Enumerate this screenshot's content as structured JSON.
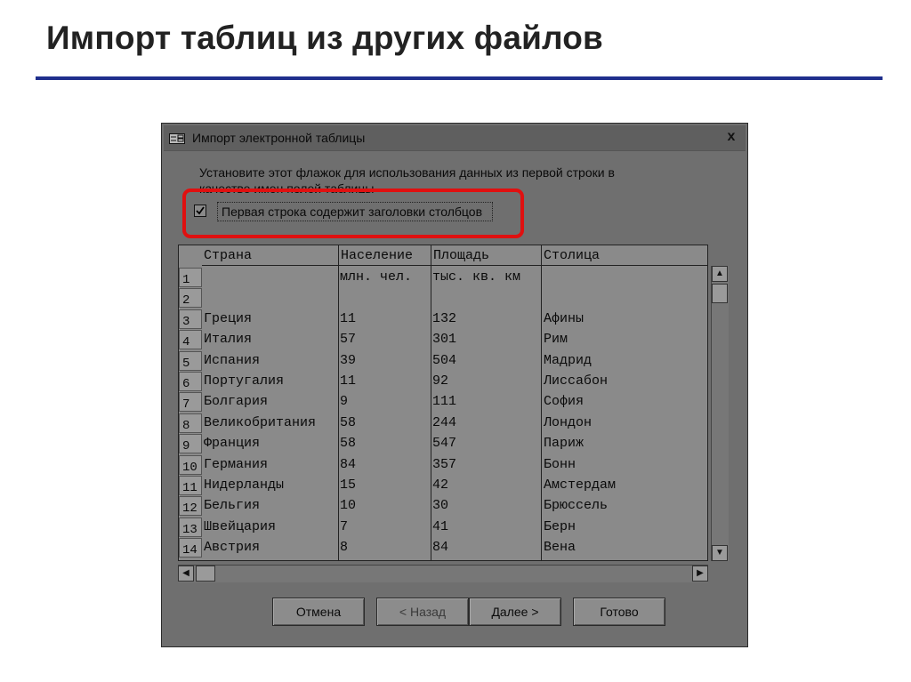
{
  "slide": {
    "title": "Импорт таблиц из других файлов",
    "accent_color": "#1f2f8c"
  },
  "dialog": {
    "title": "Импорт электронной таблицы",
    "close_label": "x",
    "instruction": "Установите этот флажок для использования данных из первой строки в качестве имен полей таблицы",
    "checkbox": {
      "label": "Первая строка содержит заголовки столбцов",
      "checked": true
    },
    "highlight_color": "#e01010"
  },
  "grid": {
    "columns": [
      "Страна",
      "Население",
      "Площадь",
      "Столица"
    ],
    "rows": [
      {
        "num": "1",
        "cells": [
          "",
          "млн. чел.",
          "тыс. кв. км",
          ""
        ]
      },
      {
        "num": "2",
        "cells": [
          "",
          "",
          "",
          ""
        ]
      },
      {
        "num": "3",
        "cells": [
          "Греция",
          "11",
          "132",
          "Афины"
        ]
      },
      {
        "num": "4",
        "cells": [
          "Италия",
          "57",
          "301",
          "Рим"
        ]
      },
      {
        "num": "5",
        "cells": [
          "Испания",
          "39",
          "504",
          "Мадрид"
        ]
      },
      {
        "num": "6",
        "cells": [
          "Португалия",
          "11",
          "92",
          "Лиссабон"
        ]
      },
      {
        "num": "7",
        "cells": [
          "Болгария",
          "9",
          "111",
          "София"
        ]
      },
      {
        "num": "8",
        "cells": [
          "Великобритания",
          "58",
          "244",
          "Лондон"
        ]
      },
      {
        "num": "9",
        "cells": [
          "Франция",
          "58",
          "547",
          "Париж"
        ]
      },
      {
        "num": "10",
        "cells": [
          "Германия",
          "84",
          "357",
          "Бонн"
        ]
      },
      {
        "num": "11",
        "cells": [
          "Нидерланды",
          "15",
          "42",
          "Амстердам"
        ]
      },
      {
        "num": "12",
        "cells": [
          "Бельгия",
          "10",
          "30",
          "Брюссель"
        ]
      },
      {
        "num": "13",
        "cells": [
          "Швейцария",
          "7",
          "41",
          "Берн"
        ]
      },
      {
        "num": "14",
        "cells": [
          "Австрия",
          "8",
          "84",
          "Вена"
        ]
      }
    ]
  },
  "scrollbars": {
    "up_icon": "triangle-up-icon",
    "down_icon": "triangle-down-icon",
    "left_icon": "triangle-left-icon",
    "right_icon": "triangle-right-icon"
  },
  "buttons": {
    "cancel": "Отмена",
    "back": "< Назад",
    "next": "Далее >",
    "finish": "Готово"
  }
}
